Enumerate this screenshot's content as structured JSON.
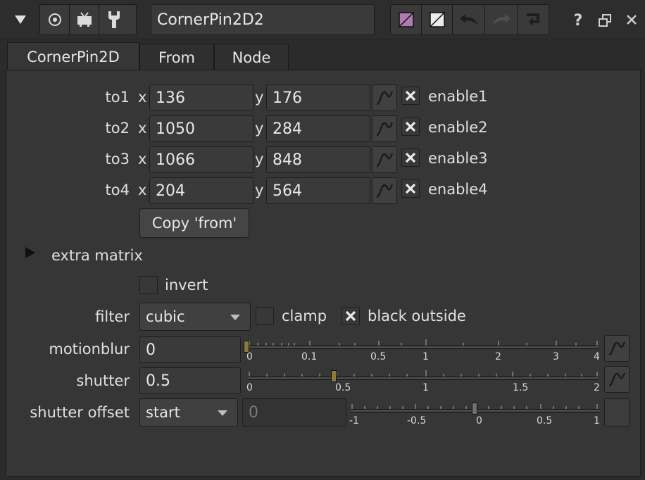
{
  "header": {
    "node_name": "CornerPin2D2"
  },
  "tabs": [
    "CornerPin2D",
    "From",
    "Node"
  ],
  "to_rows": [
    {
      "label": "to1",
      "x": "136",
      "y": "176",
      "enable": "enable1"
    },
    {
      "label": "to2",
      "x": "1050",
      "y": "284",
      "enable": "enable2"
    },
    {
      "label": "to3",
      "x": "1066",
      "y": "848",
      "enable": "enable3"
    },
    {
      "label": "to4",
      "x": "204",
      "y": "564",
      "enable": "enable4"
    }
  ],
  "axis": {
    "x": "x",
    "y": "y"
  },
  "copy_from_label": "Copy 'from'",
  "extra_matrix_label": "extra matrix",
  "invert_label": "invert",
  "filter": {
    "label": "filter",
    "value": "cubic",
    "clamp_label": "clamp",
    "black_outside_label": "black outside"
  },
  "motionblur": {
    "label": "motionblur",
    "value": "0",
    "ticks": [
      "0",
      "0.1",
      "0.5",
      "1",
      "2",
      "3",
      "4"
    ],
    "slider_level": 0
  },
  "shutter": {
    "label": "shutter",
    "value": "0.5",
    "ticks": [
      "0",
      "0.5",
      "1",
      "1.5",
      "2"
    ],
    "slider_level": 0.5
  },
  "shutter_offset": {
    "label": "shutter offset",
    "mode": "start",
    "value": "0",
    "ticks": [
      "-1",
      "-0.5",
      "0",
      "0.5",
      "1"
    ],
    "slider_level": 0
  },
  "colors": {
    "background": "#2b2b2b",
    "field": "#3a3a3a",
    "accent_handle": "#8a7a3c"
  }
}
